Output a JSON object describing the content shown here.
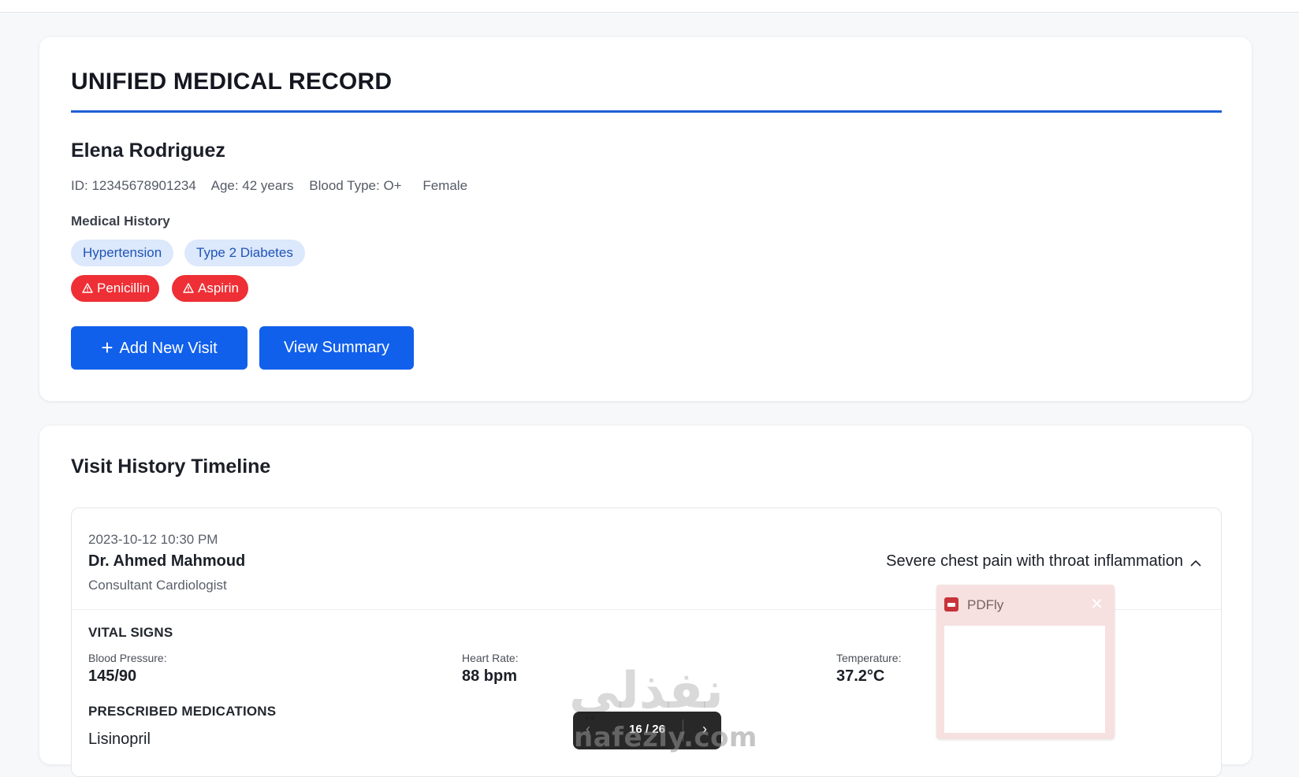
{
  "record": {
    "title": "UNIFIED MEDICAL RECORD",
    "patient": {
      "name": "Elena Rodriguez",
      "id": "ID: 12345678901234",
      "age": "Age: 42 years",
      "blood_type": "Blood Type: O+",
      "sex": "Female"
    },
    "history_label": "Medical History",
    "conditions": [
      "Hypertension",
      "Type 2 Diabetes"
    ],
    "allergies": [
      "Penicillin",
      "Aspirin"
    ],
    "actions": {
      "add_visit": "Add New Visit",
      "view_summary": "View Summary"
    }
  },
  "timeline": {
    "title": "Visit History Timeline",
    "visit": {
      "datetime": "2023-10-12 10:30 PM",
      "doctor": "Dr. Ahmed Mahmoud",
      "role": "Consultant Cardiologist",
      "complaint": "Severe chest pain with throat inflammation",
      "vitals_heading": "VITAL SIGNS",
      "vitals": [
        {
          "label": "Blood Pressure:",
          "value": "145/90"
        },
        {
          "label": "Heart Rate:",
          "value": "88 bpm"
        },
        {
          "label": "Temperature:",
          "value": "37.2°C"
        }
      ],
      "meds_heading": "PRESCRIBED MEDICATIONS",
      "medications": [
        "Lisinopril"
      ]
    }
  },
  "overlay": {
    "pdfly_name": "PDFly",
    "pager": {
      "current": "16",
      "total": "26",
      "text": "16 / 26"
    },
    "watermark_arabic": "نفذلي",
    "watermark_latin": "nafezly.com"
  },
  "colors": {
    "accent": "#1160ec",
    "rule": "#1d5fd6",
    "condition_bg": "#dce8fb",
    "allergy_bg": "#ee2f35"
  },
  "icons": {
    "add": "plus-icon",
    "allergy": "warning-triangle-icon",
    "collapse": "chevron-up-icon",
    "pdfly": "pdf-app-icon",
    "close": "close-icon",
    "prev": "chevron-left-icon",
    "next": "chevron-right-icon"
  }
}
